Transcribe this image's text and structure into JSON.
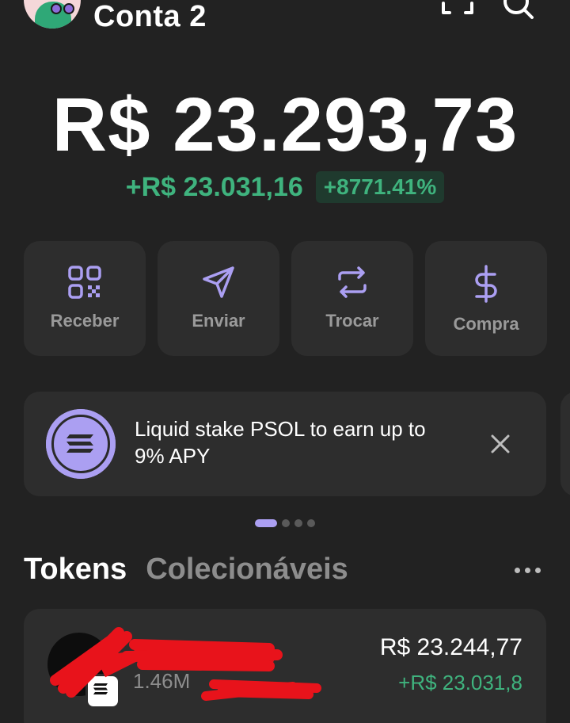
{
  "header": {
    "account_name": "Conta 2",
    "icons": [
      "avatar",
      "expand-icon",
      "search-icon"
    ]
  },
  "balance": {
    "total": "R$ 23.293,73",
    "change_value": "+R$ 23.031,16",
    "change_percent": "+8771.41%"
  },
  "actions": [
    {
      "label": "Receber",
      "icon": "qr-code-icon"
    },
    {
      "label": "Enviar",
      "icon": "send-icon"
    },
    {
      "label": "Trocar",
      "icon": "swap-icon"
    },
    {
      "label": "Compra",
      "icon": "dollar-icon"
    }
  ],
  "promo": {
    "text": "Liquid stake PSOL to earn up to 9% APY",
    "icon": "solana-icon"
  },
  "carousel": {
    "pages": 4,
    "active": 1
  },
  "tabs": [
    {
      "label": "Tokens",
      "active": true
    },
    {
      "label": "Colecionáveis",
      "active": false
    }
  ],
  "token": {
    "amount": "1.46M",
    "value": "R$ 23.244,77",
    "change": "+R$ 23.031,8"
  },
  "colors": {
    "background": "#222222",
    "card": "#2d2d2d",
    "accent": "#ab9ff2",
    "positive": "#3fb37e"
  }
}
